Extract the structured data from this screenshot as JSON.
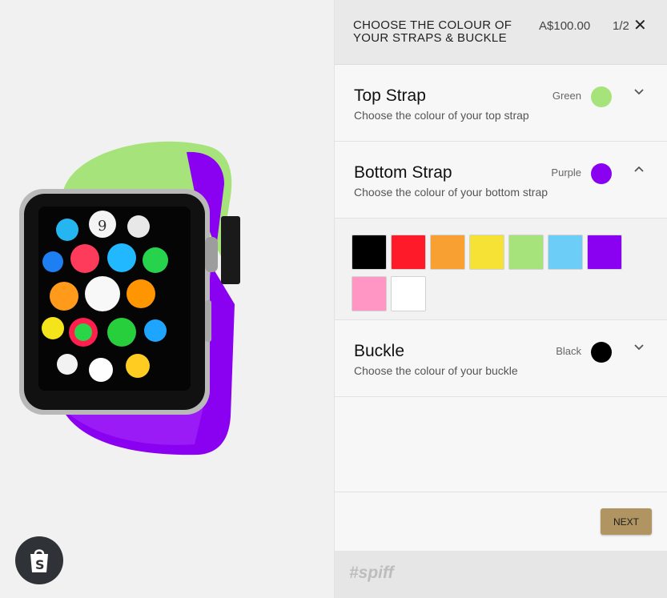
{
  "header": {
    "title": "CHOOSE THE COLOUR OF YOUR STRAPS & BUCKLE",
    "price": "A$100.00",
    "step": "1/2",
    "close_icon": "close-icon"
  },
  "options": [
    {
      "title": "Top Strap",
      "description": "Choose the colour of your top strap",
      "value": "Green",
      "color": "#a6e37b",
      "chevron": "chevron-down-icon"
    },
    {
      "title": "Bottom Strap",
      "description": "Choose the colour of your bottom strap",
      "value": "Purple",
      "color": "#8a00f0",
      "chevron": "chevron-up-icon"
    },
    {
      "title": "Buckle",
      "description": "Choose the colour of your buckle",
      "value": "Black",
      "color": "#000000",
      "chevron": "chevron-down-icon"
    }
  ],
  "palette": [
    {
      "name": "black",
      "color": "#000000"
    },
    {
      "name": "red",
      "color": "#ff1a2a"
    },
    {
      "name": "orange",
      "color": "#f9a032"
    },
    {
      "name": "yellow",
      "color": "#f6e234"
    },
    {
      "name": "green",
      "color": "#a6e37b"
    },
    {
      "name": "blue",
      "color": "#6ccdf6"
    },
    {
      "name": "purple",
      "color": "#8a00f0"
    },
    {
      "name": "pink",
      "color": "#ff96c3"
    },
    {
      "name": "white",
      "color": "#ffffff"
    }
  ],
  "actions": {
    "next_label": "NEXT"
  },
  "footer": {
    "logo": "#spiff"
  },
  "preview": {
    "watch_icon": "apple-watch-preview",
    "badge_icon": "shopify-bag-icon",
    "watch_face_digit": "9"
  }
}
